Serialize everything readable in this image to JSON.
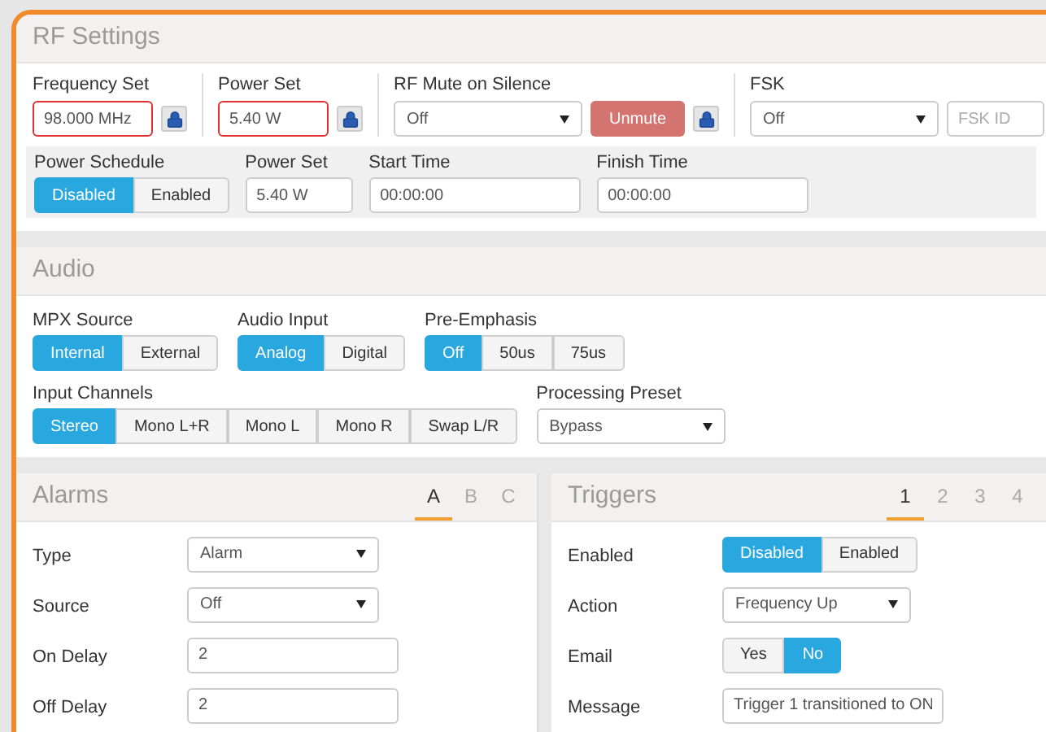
{
  "rf_settings": {
    "title": "RF Settings",
    "groups": [
      {
        "label": "Frequency Set",
        "controls": [
          {
            "kind": "input",
            "value": "98.000 MHz",
            "invalid": true
          },
          {
            "kind": "lock"
          }
        ]
      },
      {
        "label": "Power Set",
        "controls": [
          {
            "kind": "input",
            "value": "5.40 W",
            "invalid": true
          },
          {
            "kind": "lock"
          }
        ]
      },
      {
        "label": "RF Mute on Silence",
        "controls": [
          {
            "kind": "select",
            "value": "Off"
          },
          {
            "kind": "button",
            "label": "Unmute"
          },
          {
            "kind": "lock"
          }
        ]
      },
      {
        "label": "FSK",
        "controls": [
          {
            "kind": "select",
            "value": "Off"
          },
          {
            "kind": "input",
            "placeholder": "FSK ID",
            "invalid": false
          }
        ]
      }
    ],
    "schedule": [
      {
        "label": "Power Schedule",
        "control": {
          "kind": "segmented",
          "options": [
            {
              "label": "Disabled",
              "selected": true
            },
            {
              "label": "Enabled",
              "selected": false
            }
          ]
        }
      },
      {
        "label": "Power Set",
        "control": {
          "kind": "input",
          "value": "5.40 W",
          "invalid": false
        }
      },
      {
        "label": "Start Time",
        "control": {
          "kind": "input",
          "value": "00:00:00",
          "invalid": false
        }
      },
      {
        "label": "Finish Time",
        "control": {
          "kind": "input",
          "value": "00:00:00",
          "invalid": false
        }
      }
    ]
  },
  "audio": {
    "title": "Audio",
    "rows": [
      {
        "fields": [
          {
            "label": "MPX Source",
            "control": {
              "kind": "segmented",
              "options": [
                {
                  "label": "Internal",
                  "selected": true
                },
                {
                  "label": "External",
                  "selected": false
                }
              ]
            }
          },
          {
            "label": "Audio Input",
            "control": {
              "kind": "segmented",
              "options": [
                {
                  "label": "Analog",
                  "selected": true
                },
                {
                  "label": "Digital",
                  "selected": false
                }
              ]
            }
          },
          {
            "label": "Pre-Emphasis",
            "control": {
              "kind": "segmented",
              "options": [
                {
                  "label": "Off",
                  "selected": true
                },
                {
                  "label": "50us",
                  "selected": false
                },
                {
                  "label": "75us",
                  "selected": false
                }
              ]
            }
          }
        ]
      },
      {
        "fields": [
          {
            "label": "Input Channels",
            "control": {
              "kind": "segmented",
              "options": [
                {
                  "label": "Stereo",
                  "selected": true
                },
                {
                  "label": "Mono L+R",
                  "selected": false
                },
                {
                  "label": "Mono L",
                  "selected": false
                },
                {
                  "label": "Mono R",
                  "selected": false
                },
                {
                  "label": "Swap L/R",
                  "selected": false
                }
              ]
            }
          },
          {
            "label": "Processing Preset",
            "control": {
              "kind": "select",
              "value": "Bypass"
            }
          }
        ]
      }
    ]
  },
  "alarms": {
    "title": "Alarms",
    "tabs": [
      {
        "label": "A",
        "selected": true
      },
      {
        "label": "B",
        "selected": false
      },
      {
        "label": "C",
        "selected": false
      }
    ],
    "rows": [
      {
        "label": "Type",
        "control": {
          "kind": "select",
          "value": "Alarm"
        }
      },
      {
        "label": "Source",
        "control": {
          "kind": "select",
          "value": "Off"
        }
      },
      {
        "label": "On Delay",
        "control": {
          "kind": "input",
          "value": "2",
          "invalid": false
        }
      },
      {
        "label": "Off Delay",
        "control": {
          "kind": "input",
          "value": "2",
          "invalid": false
        }
      }
    ]
  },
  "triggers": {
    "title": "Triggers",
    "tabs": [
      {
        "label": "1",
        "selected": true
      },
      {
        "label": "2",
        "selected": false
      },
      {
        "label": "3",
        "selected": false
      },
      {
        "label": "4",
        "selected": false
      }
    ],
    "rows": [
      {
        "label": "Enabled",
        "control": {
          "kind": "segmented",
          "options": [
            {
              "label": "Disabled",
              "selected": true
            },
            {
              "label": "Enabled",
              "selected": false
            }
          ]
        }
      },
      {
        "label": "Action",
        "control": {
          "kind": "select",
          "value": "Frequency Up"
        }
      },
      {
        "label": "Email",
        "control": {
          "kind": "segmented",
          "options": [
            {
              "label": "Yes",
              "selected": false
            },
            {
              "label": "No",
              "selected": true
            }
          ]
        }
      },
      {
        "label": "Message",
        "control": {
          "kind": "input",
          "value": "Trigger 1 transitioned to ON",
          "invalid": false
        }
      }
    ]
  }
}
